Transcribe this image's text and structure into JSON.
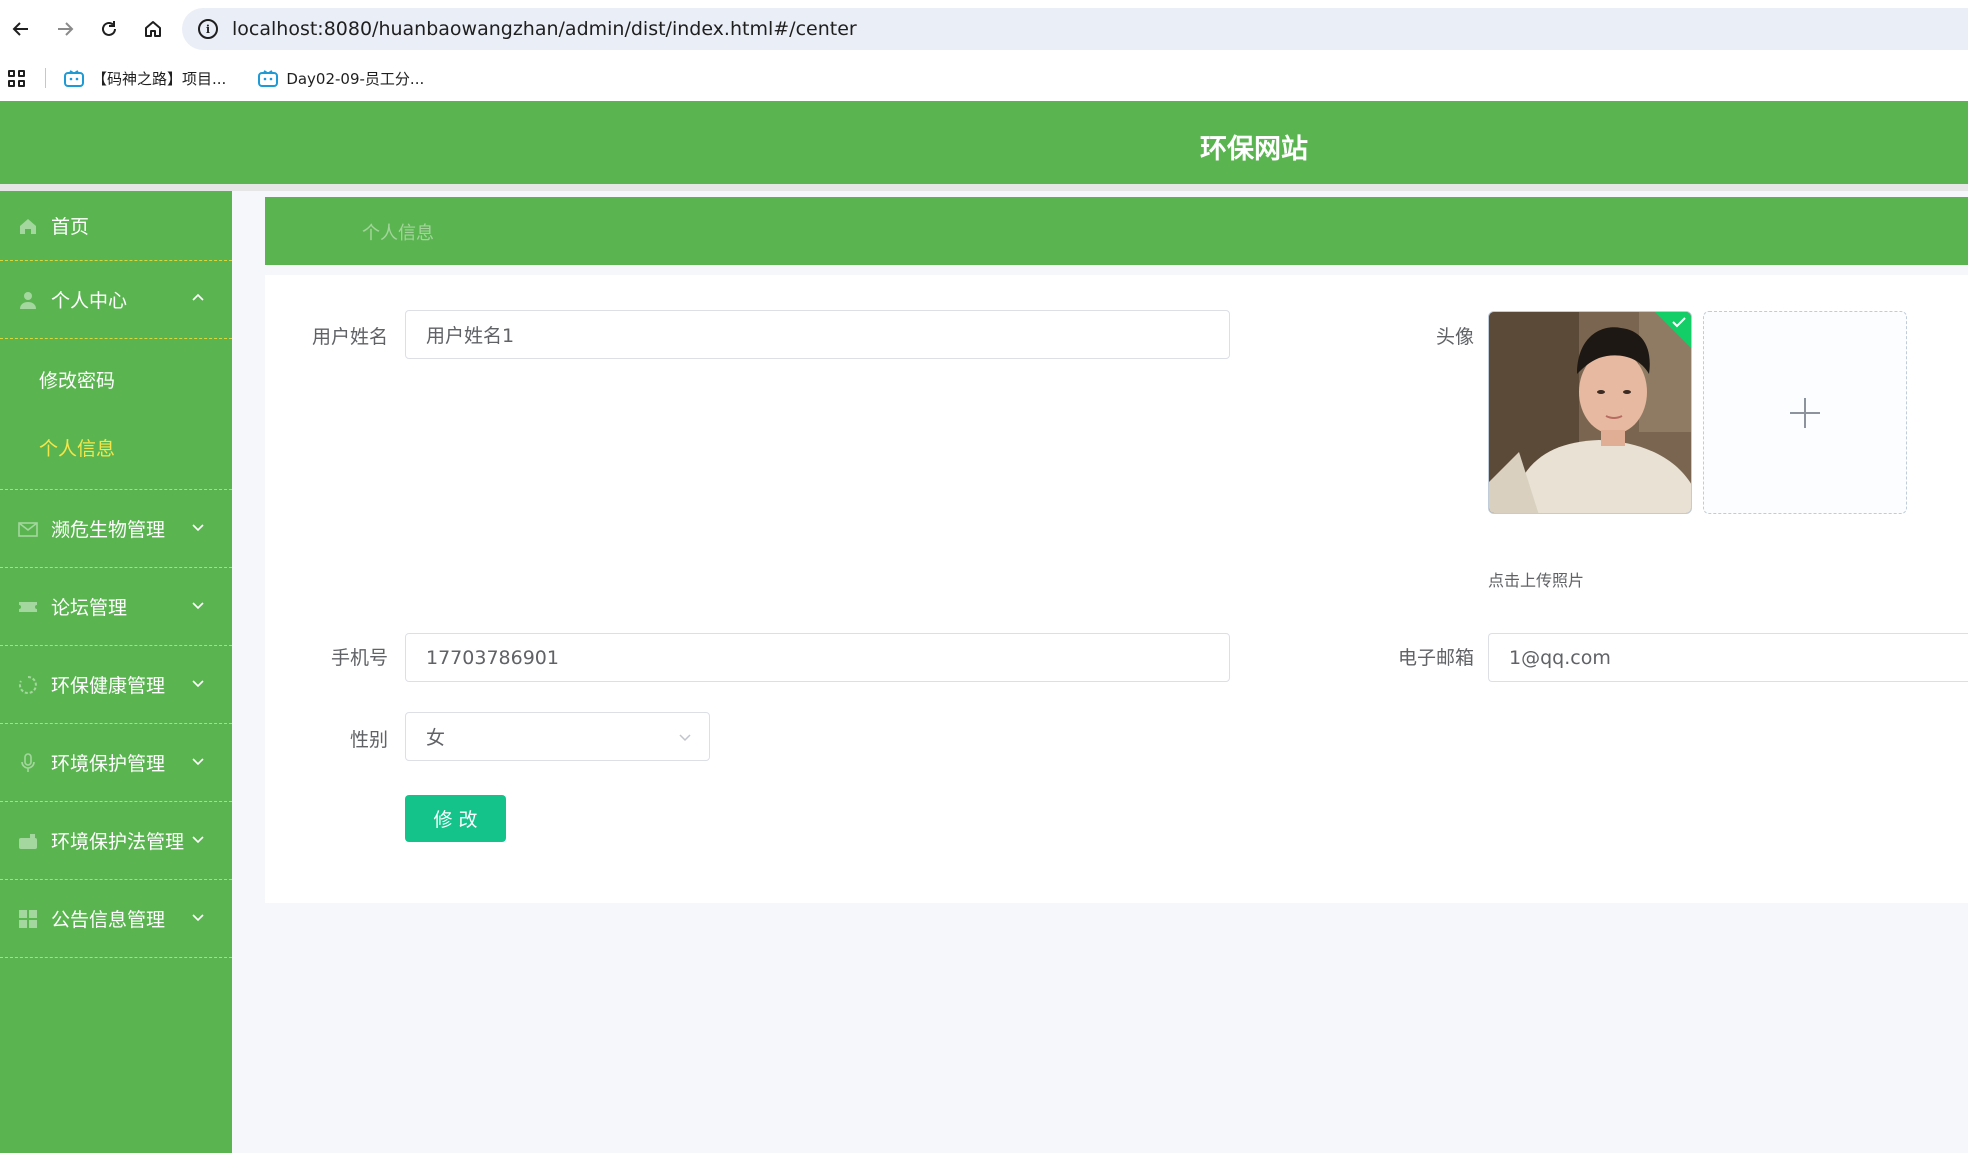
{
  "browser": {
    "url": "localhost:8080/huanbaowangzhan/admin/dist/index.html#/center",
    "bookmarks": [
      {
        "label": "【码神之路】项目..."
      },
      {
        "label": "Day02-09-员工分..."
      }
    ]
  },
  "header": {
    "title": "环保网站"
  },
  "sidebar": {
    "items": [
      {
        "label": "首页",
        "icon": "home-icon"
      },
      {
        "label": "个人中心",
        "icon": "user-icon",
        "expanded": true,
        "children": [
          {
            "label": "修改密码",
            "active": false
          },
          {
            "label": "个人信息",
            "active": true
          }
        ]
      },
      {
        "label": "濒危生物管理",
        "icon": "mail-icon"
      },
      {
        "label": "论坛管理",
        "icon": "ticket-icon"
      },
      {
        "label": "环保健康管理",
        "icon": "loading-icon"
      },
      {
        "label": "环境保护管理",
        "icon": "microphone-icon"
      },
      {
        "label": "环境保护法管理",
        "icon": "camera-icon"
      },
      {
        "label": "公告信息管理",
        "icon": "grid-icon"
      }
    ]
  },
  "breadcrumb": {
    "current": "个人信息"
  },
  "form": {
    "username": {
      "label": "用户姓名",
      "value": "用户姓名1"
    },
    "avatar": {
      "label": "头像",
      "upload_tip": "点击上传照片"
    },
    "phone": {
      "label": "手机号",
      "value": "17703786901"
    },
    "email": {
      "label": "电子邮箱",
      "value": "1@qq.com"
    },
    "gender": {
      "label": "性别",
      "value": "女"
    },
    "submit_label": "修改"
  },
  "colors": {
    "primary_green": "#5ab550",
    "active_submenu": "#f4e64a",
    "button": "#13c38a"
  }
}
